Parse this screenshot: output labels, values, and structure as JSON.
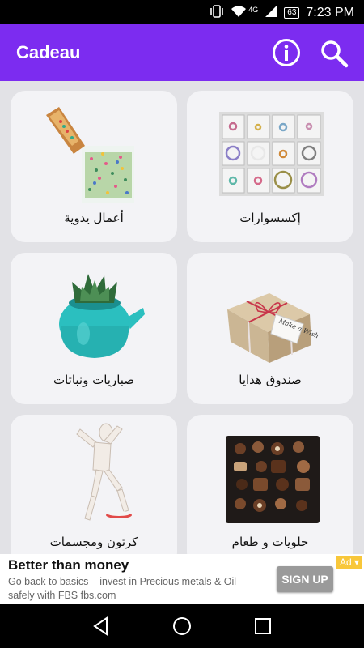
{
  "status_bar": {
    "network": "4G",
    "battery": "63",
    "time": "7:23 PM"
  },
  "app": {
    "title": "Cadeau",
    "accent_color": "#7c2cf0"
  },
  "categories": [
    {
      "label": "إكسسوارات",
      "icon": "jewelry-box-image"
    },
    {
      "label": "أعمال يدوية",
      "icon": "handmade-beads-image"
    },
    {
      "label": "صندوق هدايا",
      "icon": "gift-box-image"
    },
    {
      "label": "صباريات ونباتات",
      "icon": "cactus-pot-image"
    },
    {
      "label": "حلويات و طعام",
      "icon": "chocolate-box-image"
    },
    {
      "label": "كرتون ومجسمات",
      "icon": "wooden-figure-image"
    }
  ],
  "gift_tag_text": "Make a Wish",
  "ad": {
    "title": "Better than money",
    "body": "Go back to basics – invest in Precious metals & Oil safely with FBS fbs.com",
    "badge": "Ad",
    "cta": "SIGN UP"
  }
}
